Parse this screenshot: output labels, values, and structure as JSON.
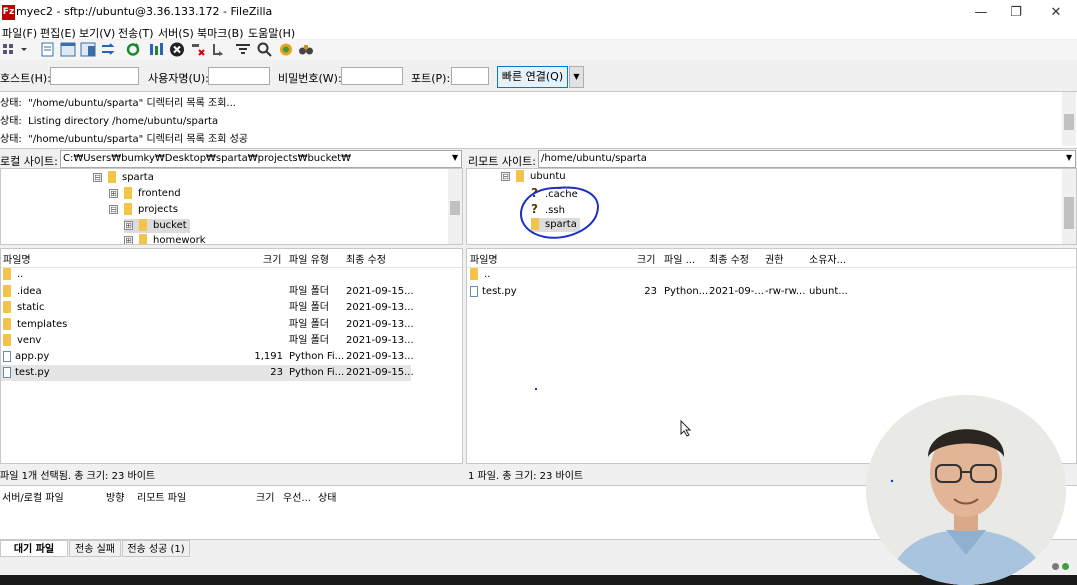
{
  "window": {
    "title": "myec2 - sftp://ubuntu@3.36.133.172 - FileZilla",
    "app_icon_text": "Fz"
  },
  "menu": [
    "파일(F)",
    "편집(E)",
    "보기(V)",
    "전송(T)",
    "서버(S)",
    "북마크(B)",
    "도움말(H)"
  ],
  "quickconnect": {
    "host_label": "호스트(H):",
    "user_label": "사용자명(U):",
    "password_label": "비밀번호(W):",
    "port_label": "포트(P):",
    "connect_label": "빠른 연결(Q)",
    "host_value": "",
    "user_value": "",
    "password_value": "",
    "port_value": ""
  },
  "log": [
    {
      "label": "상태:",
      "text": "\"/home/ubuntu/sparta\" 디렉터리 목록 조회..."
    },
    {
      "label": "상태:",
      "text": "Listing directory /home/ubuntu/sparta"
    },
    {
      "label": "상태:",
      "text": "\"/home/ubuntu/sparta\" 디렉터리 목록 조회 성공"
    }
  ],
  "local": {
    "site_label": "로컬 사이트:",
    "path": "C:₩Users₩bumky₩Desktop₩sparta₩projects₩bucket₩",
    "tree": [
      {
        "label": "sparta",
        "expander": "⊟"
      },
      {
        "label": "frontend",
        "expander": "⊞"
      },
      {
        "label": "projects",
        "expander": "⊟"
      },
      {
        "label": "bucket",
        "expander": "⊞"
      },
      {
        "label": "homework",
        "expander": "⊞"
      }
    ],
    "columns": [
      "파일명",
      "크기",
      "파일 유형",
      "최종 수정"
    ],
    "files": [
      {
        "name": "..",
        "size": "",
        "type": "",
        "modified": ""
      },
      {
        "name": ".idea",
        "size": "",
        "type": "파일 폴더",
        "modified": "2021-09-15..."
      },
      {
        "name": "static",
        "size": "",
        "type": "파일 폴더",
        "modified": "2021-09-13..."
      },
      {
        "name": "templates",
        "size": "",
        "type": "파일 폴더",
        "modified": "2021-09-13..."
      },
      {
        "name": "venv",
        "size": "",
        "type": "파일 폴더",
        "modified": "2021-09-13..."
      },
      {
        "name": "app.py",
        "size": "1,191",
        "type": "Python Fi...",
        "modified": "2021-09-13..."
      },
      {
        "name": "test.py",
        "size": "23",
        "type": "Python Fi...",
        "modified": "2021-09-15..."
      }
    ],
    "status": "파일 1개 선택됨. 총 크기: 23 바이트"
  },
  "remote": {
    "site_label": "리모트 사이트:",
    "path": "/home/ubuntu/sparta",
    "tree": [
      {
        "label": "ubuntu",
        "expander": "⊟",
        "icon": "folder"
      },
      {
        "label": ".cache",
        "icon": "unknown"
      },
      {
        "label": ".ssh",
        "icon": "unknown"
      },
      {
        "label": "sparta",
        "icon": "folder"
      }
    ],
    "columns": [
      "파일명",
      "크기",
      "파일 ...",
      "최종 수정",
      "권한",
      "소유자..."
    ],
    "files": [
      {
        "name": "..",
        "size": "",
        "type": "",
        "modified": "",
        "perm": "",
        "owner": ""
      },
      {
        "name": "test.py",
        "size": "23",
        "type": "Python...",
        "modified": "2021-09-...",
        "perm": "-rw-rw...",
        "owner": "ubunt..."
      }
    ],
    "status": "1 파일. 총 크기: 23 바이트"
  },
  "queue": {
    "columns": [
      "서버/로컬 파일",
      "방향",
      "리모트 파일",
      "크기",
      "우선...",
      "상태"
    ]
  },
  "tabs": [
    "대기 파일",
    "전송 실패",
    "전송 성공 (1)"
  ],
  "colors": {
    "annotation": "#1a2fc8",
    "selection": "#e5e5e5",
    "folder": "#f3c34c"
  }
}
